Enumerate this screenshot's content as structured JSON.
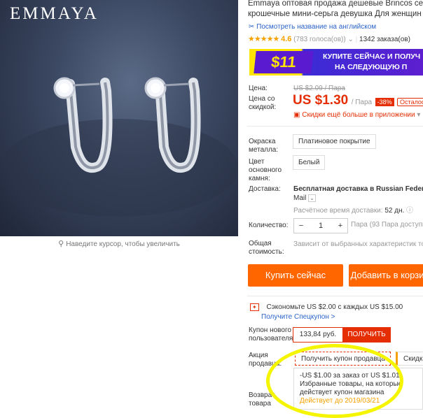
{
  "colors": {
    "accent": "#e62e04",
    "button": "#ff6600",
    "star": "#f6a100",
    "link": "#2a62c9",
    "annotation": "#f5f500"
  },
  "gallery": {
    "brand": "EMMAYA",
    "zoom_icon": "search-icon",
    "zoom_hint": "Наведите курсор, чтобы увеличить"
  },
  "product": {
    "title_line1": "Emmaya оптовая продажа дешевые Brincos сере",
    "title_line2": "крошечные мини-серьга девушка Для женщин",
    "translate_link": "Посмотреть название на английском",
    "rating": "4.6",
    "votes": "(783 голоса(ов))",
    "orders": "1342 заказа(ов)"
  },
  "banner": {
    "amount": "$11",
    "line1": "КУПИТЕ СЕЙЧАС И ПОЛУЧ",
    "line2": "НА СЛЕДУЮЩУЮ П"
  },
  "price": {
    "label": "Цена:",
    "old": "US $2.09 / Пара",
    "discount_label": "Цена со скидкой:",
    "new": "US $1.30",
    "unit": "/ Пара",
    "discount": "-38%",
    "stock": "Осталось",
    "app_promo": "Скидки ещё больше в приложении"
  },
  "options": {
    "color_label": "Окраска металла:",
    "color_value": "Платиновое покрытие",
    "stone_label": "Цвет основного камня:",
    "stone_value": "Белый"
  },
  "shipping": {
    "label": "Доставка:",
    "text": "Бесплатная доставка в Russian Federatio",
    "carrier": "Mail",
    "eta_label": "Расчётное время доставки:",
    "eta": "52 дн."
  },
  "quantity": {
    "label": "Количество:",
    "minus": "−",
    "value": "1",
    "plus": "+",
    "note": "Пара (93 Пара доступно"
  },
  "total": {
    "label": "Общая стоимость:",
    "note": "Зависит от выбранных характеристик това"
  },
  "actions": {
    "buy": "Купить сейчас",
    "cart": "Добавить в корзи"
  },
  "promo": {
    "save": "Сэкономьте US $2.00 с каждых US $15.00",
    "special": "Получите Спецкупон >",
    "new_user_label": "Купон нового пользователя",
    "coupon_value": "133,84 руб.",
    "coupon_button": "ПОЛУЧИТЬ",
    "seller_label": "Акция продавца:",
    "seller_select": "Получить купон продавца",
    "discount_select": "Скидка",
    "return_label": "Возврат товара",
    "dropdown_line1": "-US $1.00 за заказ от US $1.01",
    "dropdown_line2": "Избранные товары, на которые",
    "dropdown_line3": "действует купон магазина",
    "dropdown_valid": "Действует до 2019/03/21"
  }
}
